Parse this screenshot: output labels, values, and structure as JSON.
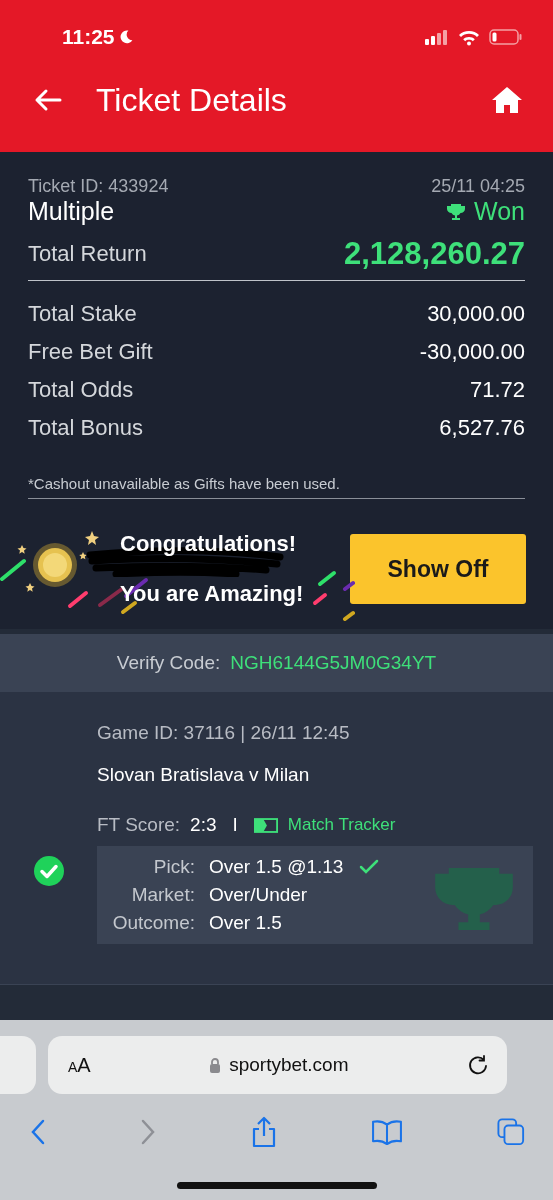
{
  "status_bar": {
    "time": "11:25"
  },
  "header": {
    "title": "Ticket Details"
  },
  "ticket": {
    "id_label": "Ticket ID: 433924",
    "date": "25/11 04:25",
    "type": "Multiple",
    "status": "Won",
    "won": true,
    "return_label": "Total Return",
    "return_value": "2,128,260.27",
    "rows": [
      {
        "label": "Total Stake",
        "value": "30,000.00"
      },
      {
        "label": "Free Bet Gift",
        "value": "-30,000.00"
      },
      {
        "label": "Total Odds",
        "value": "71.72"
      },
      {
        "label": "Total Bonus",
        "value": "6,527.76"
      }
    ],
    "note": "*Cashout unavailable as Gifts have been used."
  },
  "banner": {
    "line_1": "Congratulations!",
    "line_2": "You are Amazing!",
    "button": "Show Off"
  },
  "verify": {
    "label": "Verify Code:",
    "code": "NGH6144G5JM0G34YT"
  },
  "selections": [
    {
      "won": true,
      "game": "Game ID: 37116 | 26/11 12:45",
      "match": "Slovan Bratislava v Milan",
      "score_label": "FT Score:",
      "score": "2:3",
      "separator": "I",
      "tracker": "Match Tracker",
      "pick_check": true,
      "details": [
        {
          "label": "Pick:",
          "value": "Over 1.5 @1.13"
        },
        {
          "label": "Market:",
          "value": "Over/Under"
        },
        {
          "label": "Outcome:",
          "value": "Over 1.5"
        }
      ]
    }
  ],
  "browser": {
    "text_size": "aA",
    "url": "sportybet.com",
    "forward_disabled": true
  }
}
